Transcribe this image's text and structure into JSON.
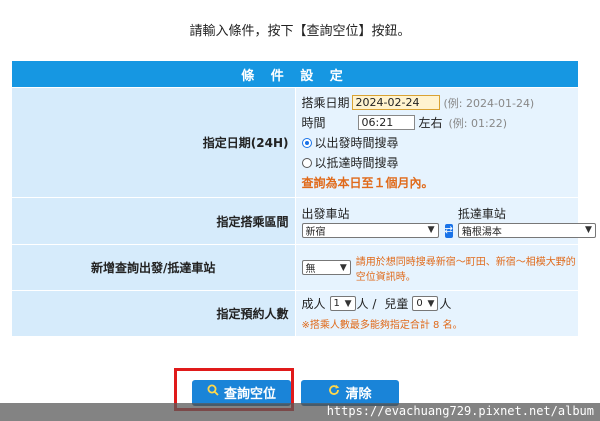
{
  "instruction": "請輸入條件，按下【查詢空位】按鈕。",
  "form": {
    "title": "條 件 設 定",
    "date_row": {
      "label": "指定日期(24H)",
      "date_label": "搭乘日期",
      "date_value": "2024-02-24",
      "date_hint": "(例: 2024-01-24)",
      "time_label": "時間",
      "time_value": "06:21",
      "time_suffix": "左右",
      "time_hint": "(例: 01:22)",
      "radio_depart": "以出發時間搜尋",
      "radio_arrive": "以抵達時間搜尋",
      "range_note": "查詢為本日至１個月內。"
    },
    "section_row": {
      "label": "指定搭乘區間",
      "depart_label": "出發車站",
      "depart_value": "新宿",
      "arrive_label": "抵達車站",
      "arrive_value": "箱根湯本"
    },
    "add_row": {
      "label": "新增查詢出發/抵達車站",
      "select_value": "無",
      "note": "請用於想同時搜尋新宿～町田、新宿～相模大野的空位資訊時。"
    },
    "people_row": {
      "label": "指定預約人數",
      "adult_label": "成人",
      "adult_value": "1",
      "adult_unit": "人 /",
      "child_label": "兒童",
      "child_value": "0",
      "child_unit": "人",
      "note": "※搭乘人數最多能夠指定合計 8 名。"
    }
  },
  "buttons": {
    "search": "查詢空位",
    "clear": "清除"
  },
  "watermark": "https://evachuang729.pixnet.net/album",
  "colors": {
    "header_blue": "#1697e2",
    "button_blue": "#1a84d8",
    "warning_orange": "#e06a1a",
    "highlight_red": "#e01a1a"
  }
}
